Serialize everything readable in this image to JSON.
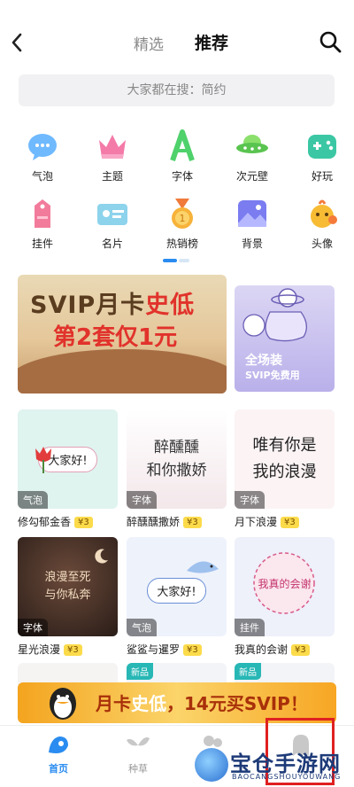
{
  "header": {
    "back_icon": "chevron-left-icon",
    "tabs": [
      "精选",
      "推荐"
    ],
    "search_icon": "search-icon"
  },
  "search": {
    "placeholder": "大家都在搜：简约"
  },
  "categories": [
    {
      "label": "气泡",
      "icon": "bubble-icon"
    },
    {
      "label": "主题",
      "icon": "crown-icon"
    },
    {
      "label": "字体",
      "icon": "font-icon"
    },
    {
      "label": "次元壁",
      "icon": "ufo-icon"
    },
    {
      "label": "好玩",
      "icon": "gamepad-icon"
    },
    {
      "label": "挂件",
      "icon": "tag-icon"
    },
    {
      "label": "名片",
      "icon": "card-icon"
    },
    {
      "label": "热销榜",
      "icon": "medal-icon"
    },
    {
      "label": "背景",
      "icon": "picture-icon"
    },
    {
      "label": "头像",
      "icon": "avatar-icon"
    }
  ],
  "banner": {
    "line1a": "SVIP",
    "line1b": "月卡",
    "line1c": "史低",
    "line2": "第2套仅1元"
  },
  "side_banner": {
    "line1": "全场装",
    "line2": "SVIP免费用"
  },
  "grid": [
    {
      "tag": "气泡",
      "title": "修勾郁金香",
      "price": "¥3",
      "art": "大家好!"
    },
    {
      "tag": "字体",
      "title": "醉醺醺撒娇",
      "price": "¥3",
      "art": "醉醺醺\n和你撒娇"
    },
    {
      "tag": "字体",
      "title": "月下浪漫",
      "price": "¥3",
      "art": "唯有你是\n我的浪漫"
    },
    {
      "tag": "字体",
      "title": "星光浪漫",
      "price": "¥3",
      "art": "浪漫至死\n与你私奔"
    },
    {
      "tag": "气泡",
      "title": "鲨鲨与暹罗",
      "price": "¥3",
      "art": "大家好!"
    },
    {
      "tag": "挂件",
      "title": "我真的会谢",
      "price": "¥3",
      "art": "我真的会谢"
    }
  ],
  "new_badge": "新品",
  "promo": {
    "text_a": "月卡",
    "text_b": "史低",
    "text_c": "，14元买SVIP！"
  },
  "tabbar": [
    {
      "label": "首页",
      "icon": "home-icon",
      "active": true
    },
    {
      "label": "种草",
      "icon": "leaf-icon",
      "active": false
    }
  ],
  "watermark": {
    "title": "宝仓手游网",
    "subtitle": "BAOCANGSHOUYOUWANG"
  },
  "colors": {
    "accent": "#2a8cf0",
    "price_bg": "#fcdb4b",
    "highlight_box": "#e02020"
  }
}
